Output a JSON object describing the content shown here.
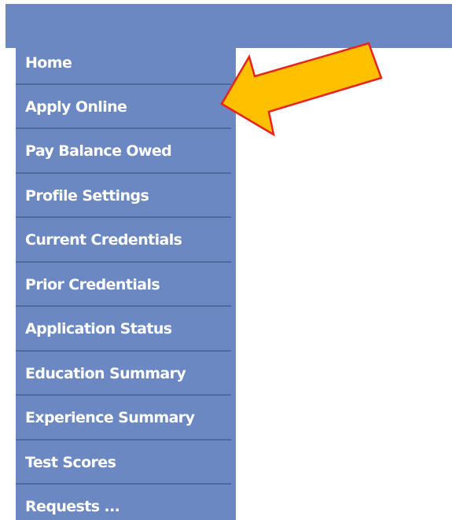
{
  "nav": {
    "items": [
      {
        "label": "Home"
      },
      {
        "label": "Apply Online"
      },
      {
        "label": "Pay Balance Owed"
      },
      {
        "label": "Profile Settings"
      },
      {
        "label": "Current Credentials"
      },
      {
        "label": "Prior Credentials"
      },
      {
        "label": "Application Status"
      },
      {
        "label": "Education Summary"
      },
      {
        "label": "Experience Summary"
      },
      {
        "label": "Test Scores"
      },
      {
        "label": "Requests ..."
      }
    ]
  },
  "annotation": {
    "icon": "arrow-left-icon",
    "fill_color": "#FFC000",
    "stroke_color": "#E8231C"
  },
  "colors": {
    "nav_background": "#6B88C2",
    "nav_divider": "#4E6B9E",
    "nav_text": "#FFFFFF"
  }
}
